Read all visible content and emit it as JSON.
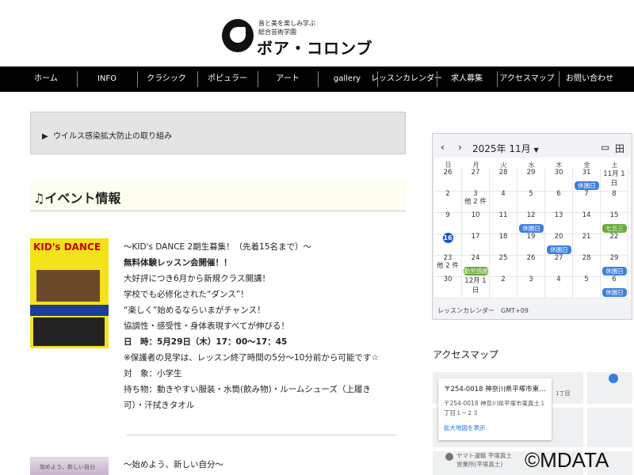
{
  "logo": {
    "tagline1": "音と美を楽しみ学ぶ",
    "tagline2": "総合芸術学園",
    "name": "ボア・コロンブ"
  },
  "nav": [
    "ホーム",
    "INFO",
    "クラシック",
    "ポピュラー",
    "アート",
    "gallery",
    "レッスンカレンダー",
    "求人募集",
    "アクセスマップ",
    "お問い合わせ"
  ],
  "covid": "ウイルス感染拡大防止の取り組み",
  "event_heading": "イベント情報",
  "poster": {
    "title": "KID's DANCE"
  },
  "event1": [
    "〜KID's DANCE 2期生募集！（先着15名まで）〜",
    "無料体験レッスン会開催！！",
    "大好評につき6月から新規クラス開講！",
    "学校でも必修化された“ダンス”！",
    "“楽しく”始めるならいまがチャンス！",
    "協調性・感受性・身体表現すべてが伸びる！",
    "日　時：5月29日（木）17：00〜17：45",
    "※保護者の見学は、レッスン終了時間の5分〜10分前から可能です☆",
    "対　象：小学生",
    "持ち物：動きやすい服装・水筒(飲み物)・ルームシューズ（上履き",
    "可）・汗拭きタオル"
  ],
  "poster2": {
    "title": "始めよう、新しい自分"
  },
  "event2": "〜始めよう、新しい自分〜",
  "calendar": {
    "month": "2025年 11月",
    "weekdays": [
      "日",
      "月",
      "火",
      "水",
      "木",
      "金",
      "土"
    ],
    "weeks": [
      [
        {
          "d": "26"
        },
        {
          "d": "27"
        },
        {
          "d": "28"
        },
        {
          "d": "29"
        },
        {
          "d": "30"
        },
        {
          "d": "31",
          "e": "休園日",
          "c": "#3f7fe0"
        },
        {
          "d": "11月 1日"
        }
      ],
      [
        {
          "d": "2"
        },
        {
          "d": "3",
          "m": "他 2 件"
        },
        {
          "d": "4"
        },
        {
          "d": "5"
        },
        {
          "d": "6"
        },
        {
          "d": "7"
        },
        {
          "d": "8"
        }
      ],
      [
        {
          "d": "9"
        },
        {
          "d": "10"
        },
        {
          "d": "11"
        },
        {
          "d": "12",
          "e": "休園日",
          "c": "#3f7fe0"
        },
        {
          "d": "13"
        },
        {
          "d": "14"
        },
        {
          "d": "15",
          "e": "七五三",
          "c": "#6aaa3a"
        }
      ],
      [
        {
          "d": "16",
          "today": true
        },
        {
          "d": "17"
        },
        {
          "d": "18"
        },
        {
          "d": "19"
        },
        {
          "d": "20",
          "e": "休園日",
          "c": "#3f7fe0"
        },
        {
          "d": "21"
        },
        {
          "d": "22"
        }
      ],
      [
        {
          "d": "23",
          "m": "他 2 件"
        },
        {
          "d": "24",
          "e": "勤労感謝",
          "c": "#6aaa3a"
        },
        {
          "d": "25"
        },
        {
          "d": "26"
        },
        {
          "d": "27"
        },
        {
          "d": "28"
        },
        {
          "d": "29",
          "e": "休園日",
          "c": "#3f7fe0"
        }
      ],
      [
        {
          "d": "30"
        },
        {
          "d": "12月 1日"
        },
        {
          "d": "2"
        },
        {
          "d": "3"
        },
        {
          "d": "4"
        },
        {
          "d": "5"
        },
        {
          "d": "6",
          "e": "休園日",
          "c": "#3f7fe0"
        }
      ]
    ],
    "footer": "レッスンカレンダー　GMT+09"
  },
  "map": {
    "heading": "アクセスマップ",
    "title": "〒254-0018 神奈川県平塚市東…",
    "address": "〒254-0018 神奈川県平塚市東真土１丁目１−２３",
    "link": "拡大地図を表示",
    "place": "ヤマト運輸 平塚真土営業所(平塚真土)",
    "area": "1丁目"
  },
  "watermark": "©MDATA"
}
